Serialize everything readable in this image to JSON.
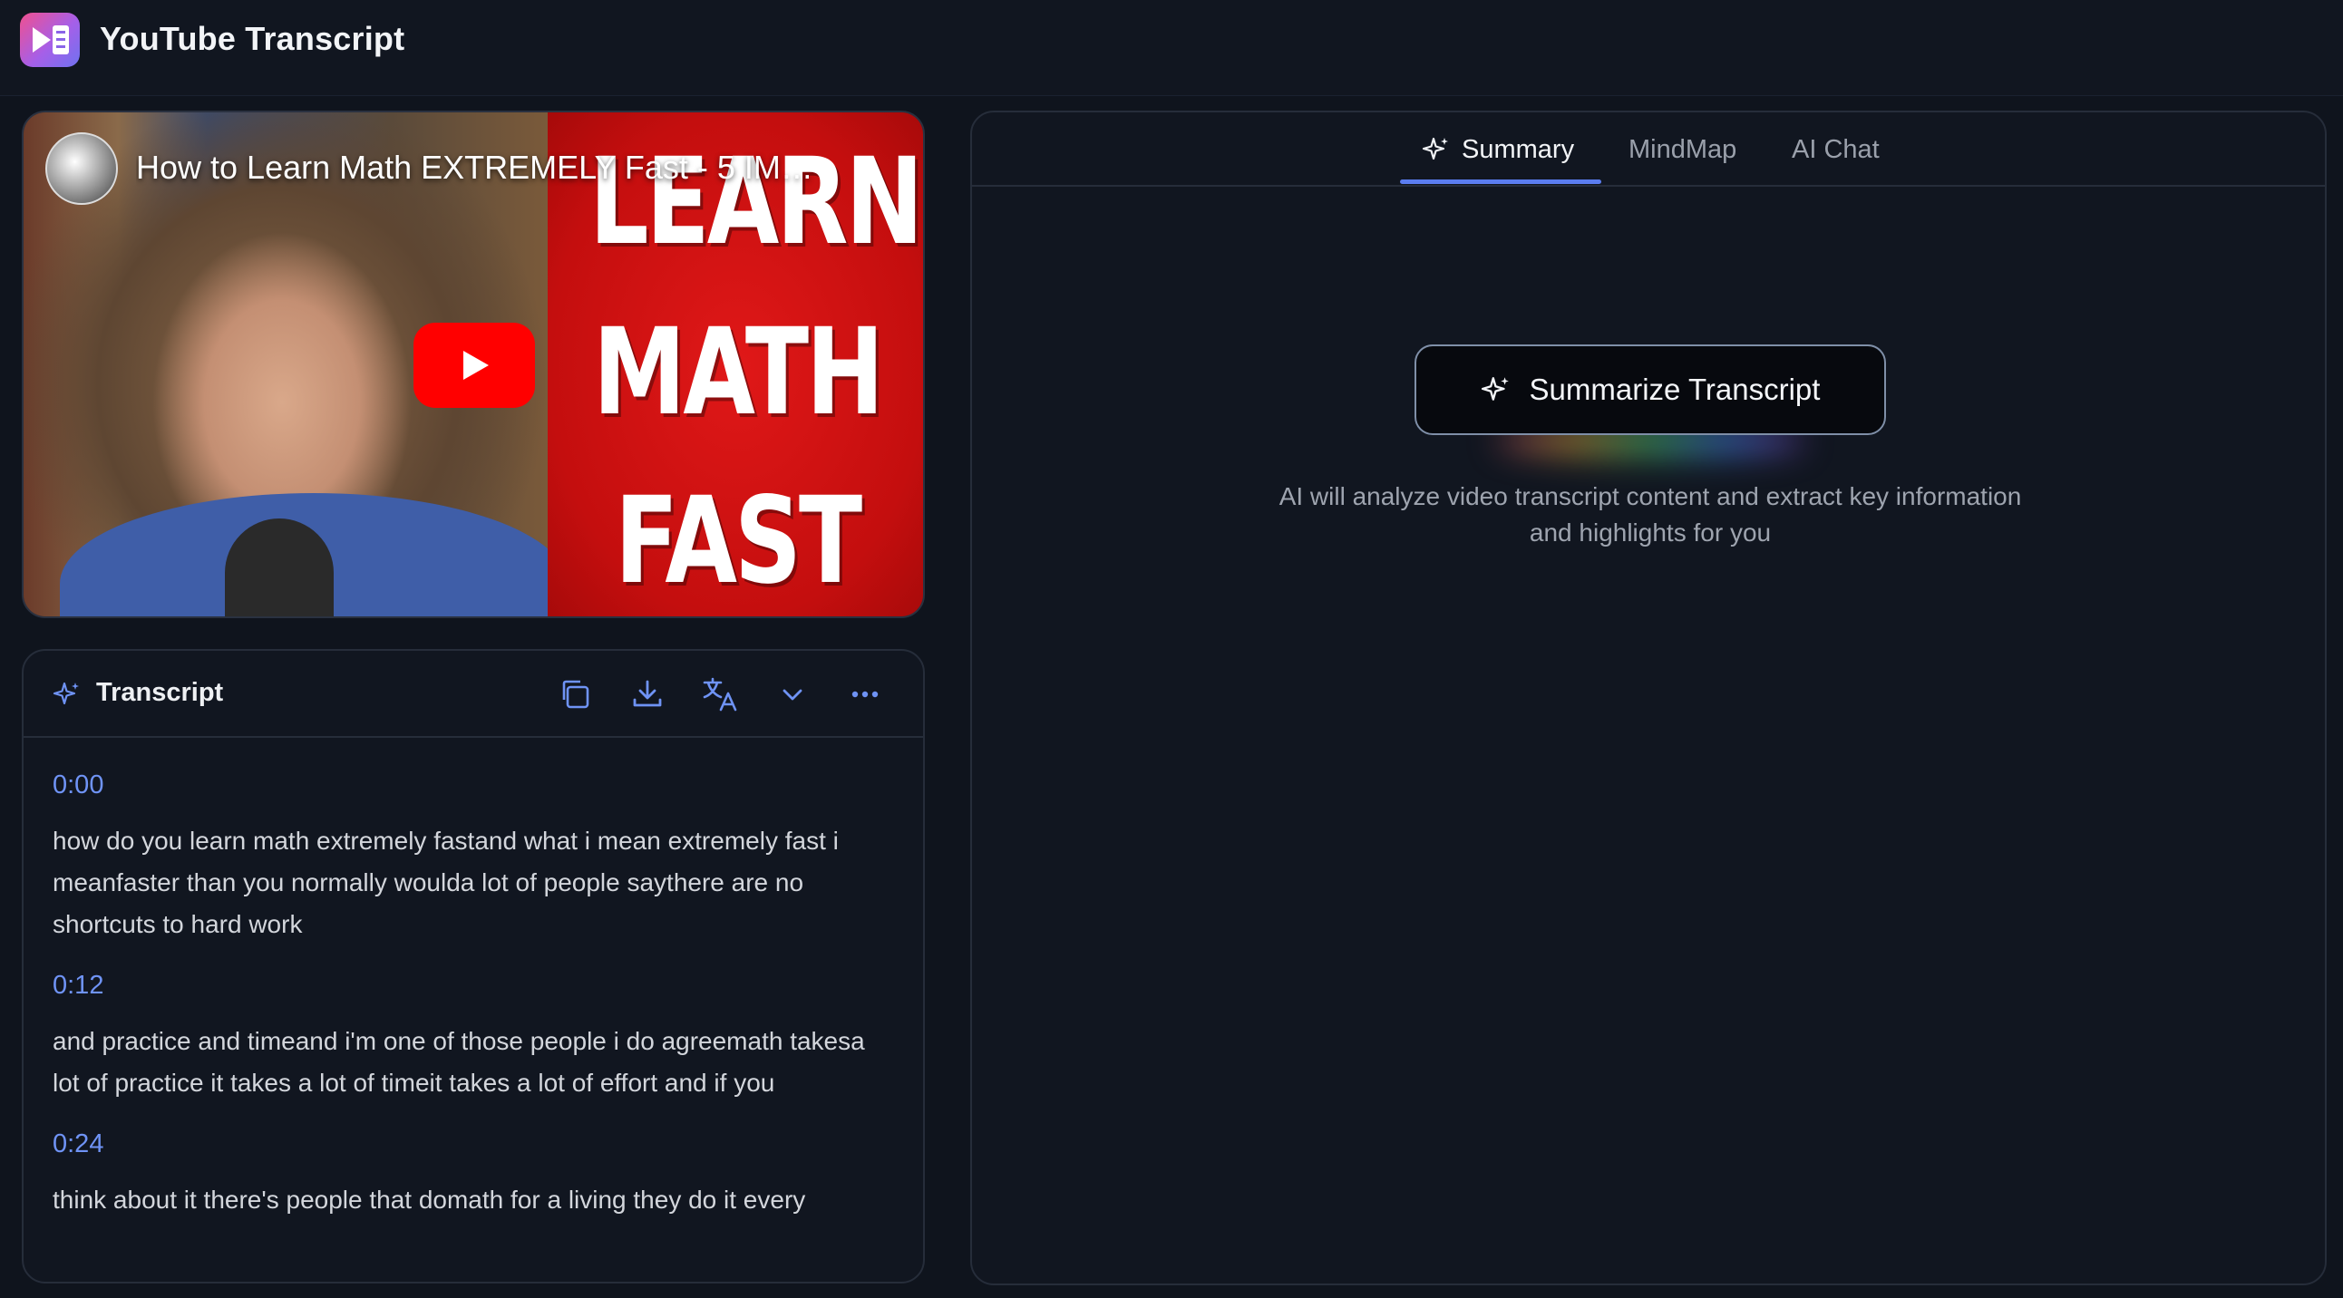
{
  "app": {
    "title": "YouTube Transcript"
  },
  "video": {
    "title": "How to Learn Math EXTREMELY Fast - 5 IMP...",
    "thumbnail_words": [
      "LEARN",
      "MATH",
      "FAST"
    ]
  },
  "transcript": {
    "title": "Transcript",
    "segments": [
      {
        "time": "0:00",
        "text": "how do you learn math extremely fastand what i mean extremely fast i meanfaster than you normally woulda lot of people saythere are no shortcuts to hard work"
      },
      {
        "time": "0:12",
        "text": "and practice and timeand i'm one of those people i do agreemath takesa lot of practice it takes a lot of timeit takes a lot of effort and if you"
      },
      {
        "time": "0:24",
        "text": "think about it there's people that domath for a living they do it every"
      }
    ]
  },
  "tabs": [
    {
      "label": "Summary",
      "active": true
    },
    {
      "label": "MindMap",
      "active": false
    },
    {
      "label": "AI Chat",
      "active": false
    }
  ],
  "summary": {
    "button_label": "Summarize Transcript",
    "helper_line1": "AI will analyze video transcript content and extract key information",
    "helper_line2": "and highlights for you"
  },
  "colors": {
    "accent": "#5b7df0",
    "timestamp": "#6f93f5",
    "play": "#ff0000"
  }
}
